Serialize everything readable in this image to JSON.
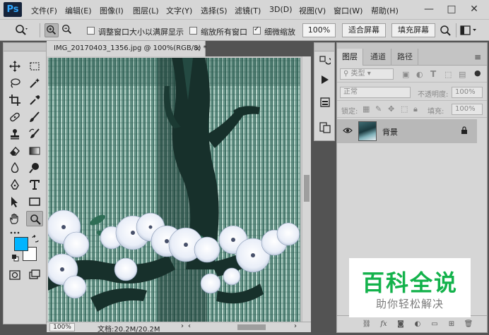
{
  "app": {
    "logo": "Ps"
  },
  "menu": [
    "文件(F)",
    "编辑(E)",
    "图像(I)",
    "图层(L)",
    "文字(Y)",
    "选择(S)",
    "滤镜(T)",
    "3D(D)",
    "视图(V)",
    "窗口(W)",
    "帮助(H)"
  ],
  "window_controls": {
    "minimize": "—",
    "maximize": "□",
    "close": "✕"
  },
  "options": {
    "resize_windows_label": "调整窗口大小以满屏显示",
    "resize_windows_checked": false,
    "zoom_all_label": "缩放所有窗口",
    "zoom_all_checked": false,
    "scrubby_zoom_label": "细微缩放",
    "scrubby_zoom_checked": true,
    "zoom_value": "100%",
    "fit_screen_label": "适合屏幕",
    "fill_screen_label": "填充屏幕"
  },
  "document": {
    "tab_title": "IMG_20170403_1356.jpg @ 100%(RGB/8) *",
    "tab_close": "×",
    "zoom": "100%",
    "info": "文档:20.2M/20.2M"
  },
  "colors": {
    "foreground": "#00b4ff",
    "background": "#ffffff"
  },
  "layers_panel": {
    "tabs": [
      "图层",
      "通道",
      "路径"
    ],
    "active_tab": "图层",
    "kind_filter": "类型",
    "blend_mode": "正常",
    "opacity_label": "不透明度:",
    "opacity_value": "100%",
    "lock_label": "锁定:",
    "fill_label": "填充:",
    "fill_value": "100%",
    "layers": [
      {
        "name": "背景",
        "visible": true,
        "locked": true
      }
    ]
  },
  "watermark": {
    "title": "百科全说",
    "subtitle": "助你轻松解决"
  }
}
